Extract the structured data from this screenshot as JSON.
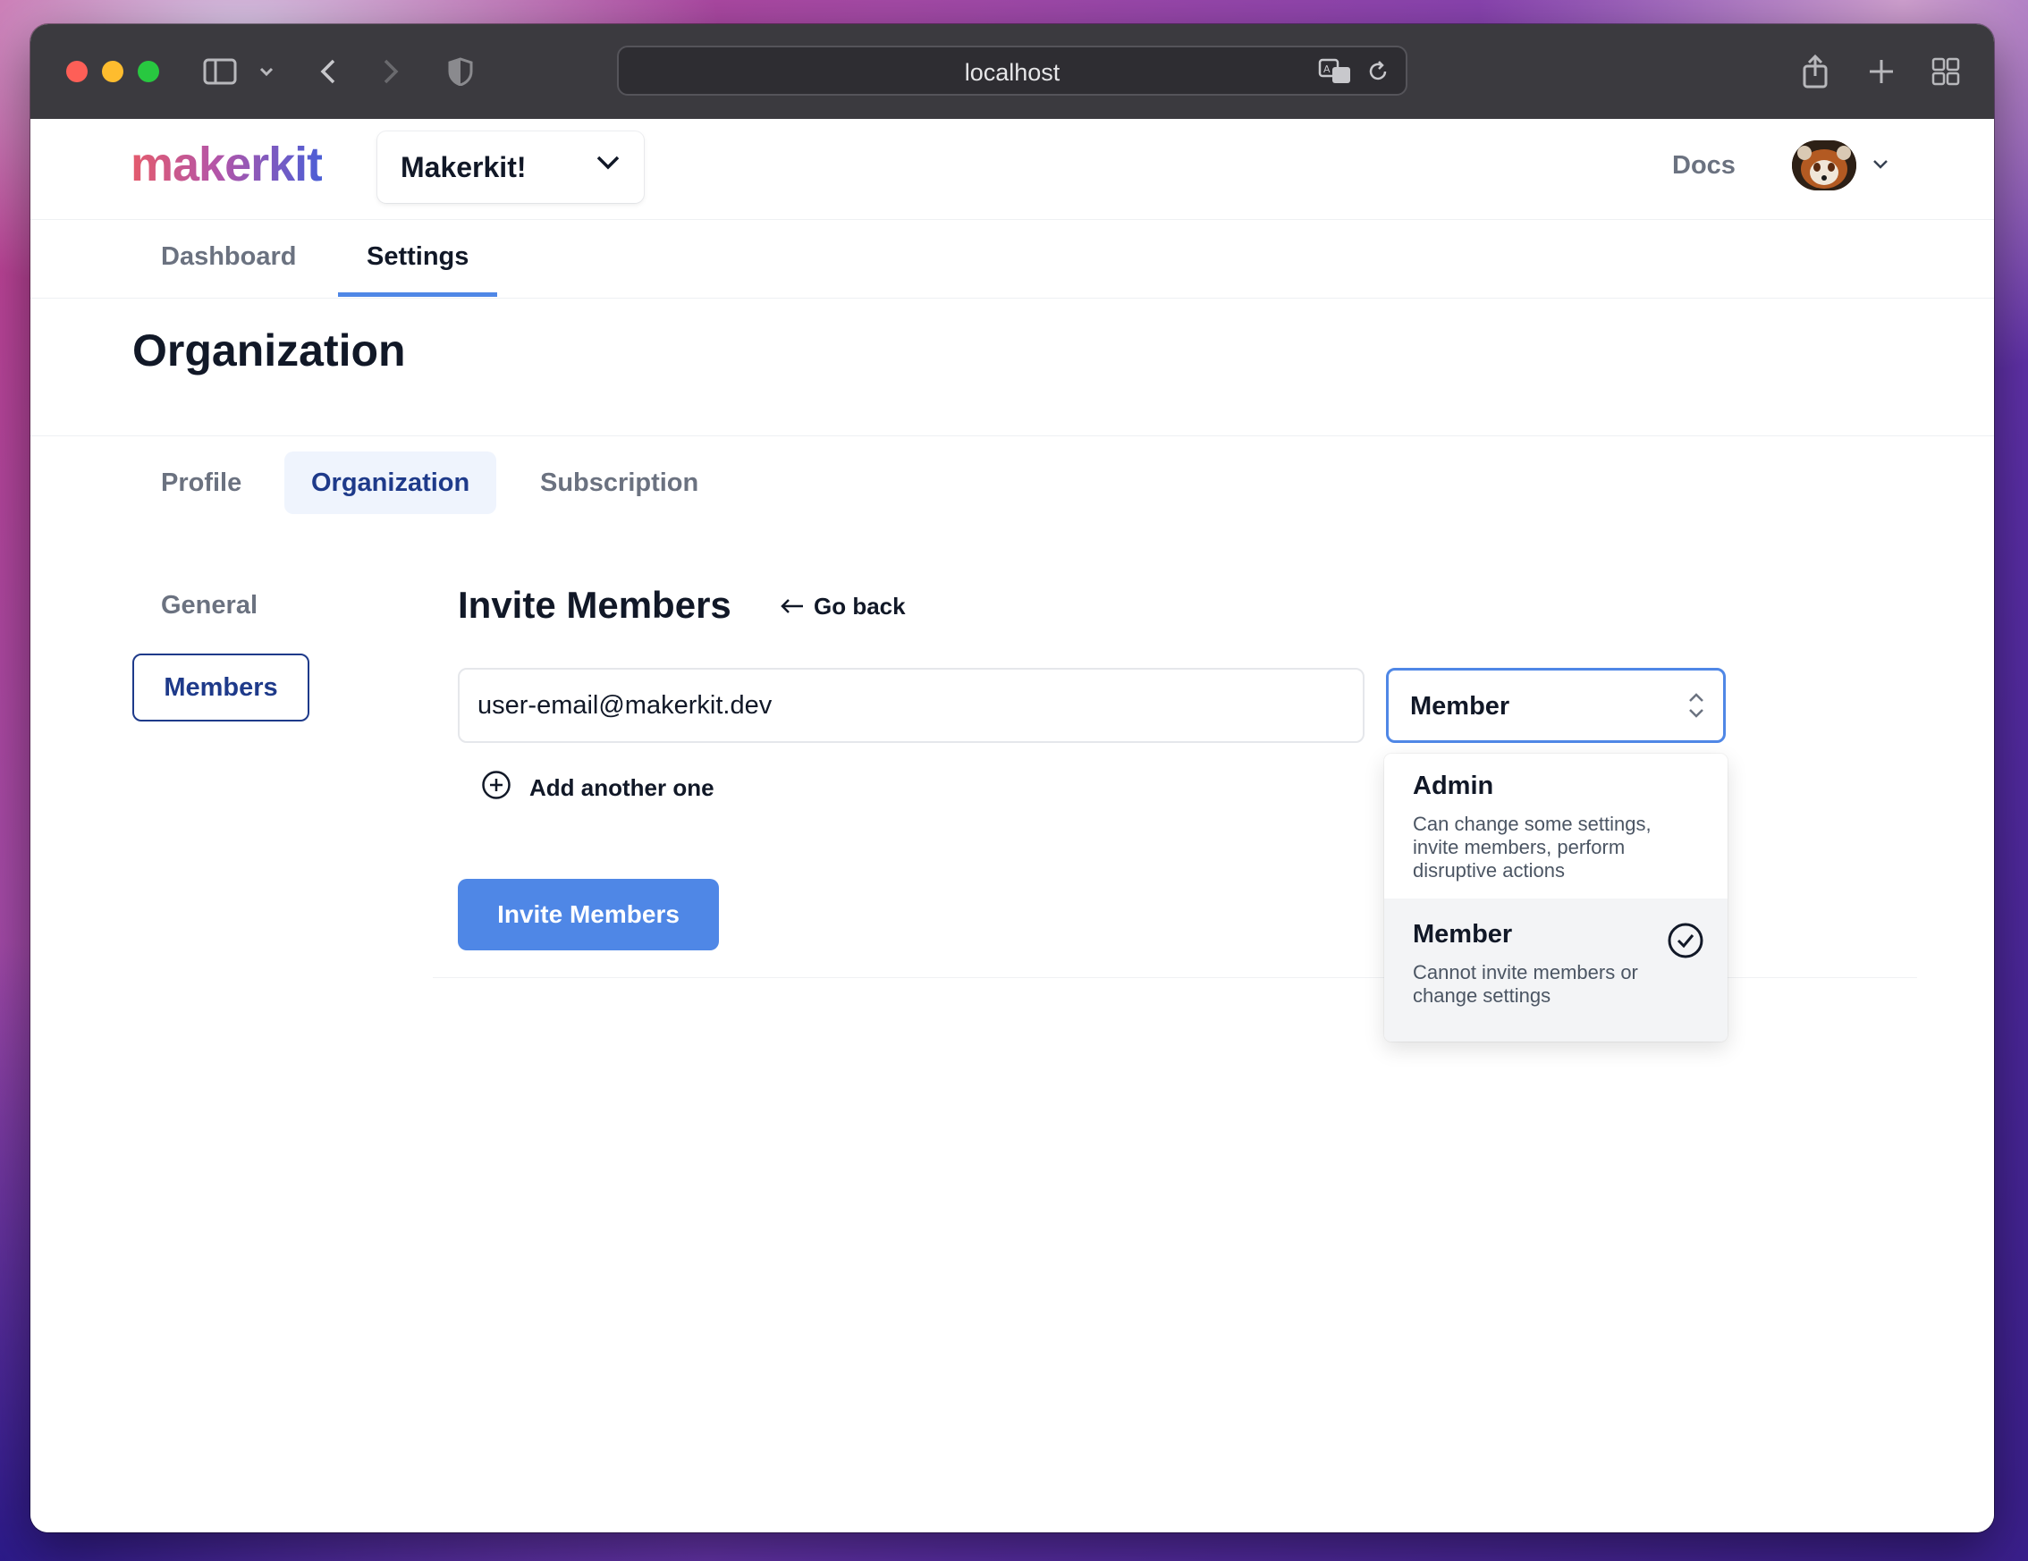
{
  "browser": {
    "url": "localhost"
  },
  "header": {
    "logo_text": "makerkit",
    "org_name": "Makerkit!",
    "docs_label": "Docs"
  },
  "main_tabs": [
    {
      "label": "Dashboard",
      "active": false
    },
    {
      "label": "Settings",
      "active": true
    }
  ],
  "page": {
    "title": "Organization"
  },
  "sub_tabs": [
    {
      "label": "Profile",
      "active": false
    },
    {
      "label": "Organization",
      "active": true
    },
    {
      "label": "Subscription",
      "active": false
    }
  ],
  "side_nav": [
    {
      "label": "General",
      "active": false
    },
    {
      "label": "Members",
      "active": true
    }
  ],
  "invite": {
    "title": "Invite Members",
    "go_back": "Go back",
    "email_value": "user-email@makerkit.dev",
    "role_value": "Member",
    "add_another": "Add another one",
    "submit": "Invite Members"
  },
  "role_options": [
    {
      "title": "Admin",
      "description": "Can change some settings, invite members, perform disruptive actions",
      "selected": false
    },
    {
      "title": "Member",
      "description": "Cannot invite members or change settings",
      "selected": true
    }
  ],
  "colors": {
    "accent": "#4f87e6",
    "active_text": "#1e3a8a"
  }
}
